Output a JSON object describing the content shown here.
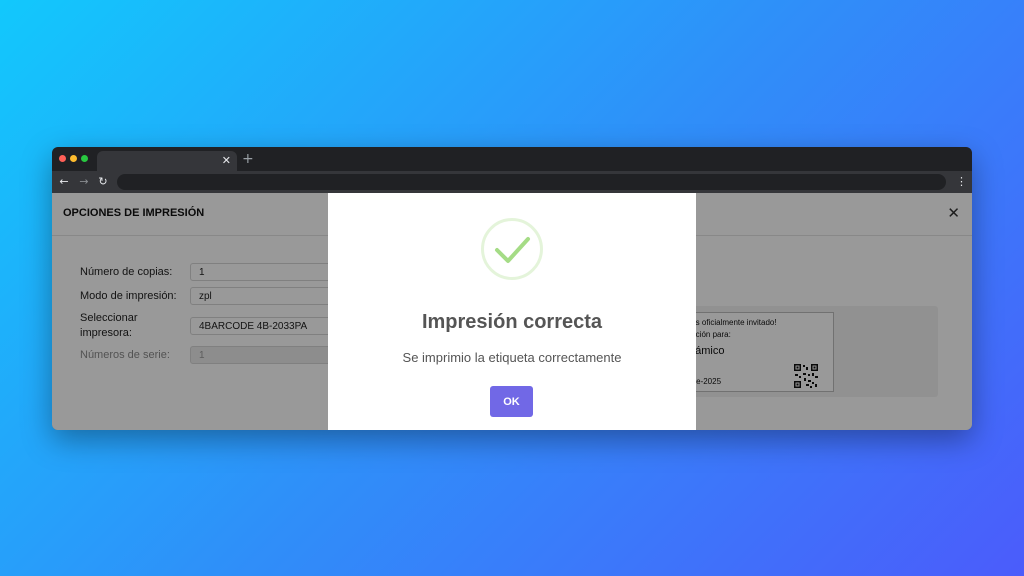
{
  "browser": {
    "tab_close": "✕",
    "new_tab": "+",
    "back": "←",
    "forward": "→",
    "reload": "↻",
    "menu": "⋮"
  },
  "page": {
    "title": "OPCIONES DE IMPRESIÓN",
    "close": "✕",
    "form": {
      "copies_label": "Número de copias:",
      "copies_value": "1",
      "mode_label": "Modo de impresión:",
      "mode_value": "zpl",
      "printer_label_line1": "Seleccionar",
      "printer_label_line2": "impresora:",
      "printer_value": "4BARCODE 4B-2033PA",
      "serial_label": "Números de serie:",
      "serial_value": "1"
    },
    "preview": {
      "line1": "tas oficialmente invitado!",
      "line2": "tación para:",
      "name": "námico",
      "date": "ore-2025"
    }
  },
  "modal": {
    "title": "Impresión correcta",
    "message": "Se imprimio la etiqueta correctamente",
    "ok_label": "OK",
    "success_color": "#a5dc86",
    "ok_color": "#7168e6"
  }
}
